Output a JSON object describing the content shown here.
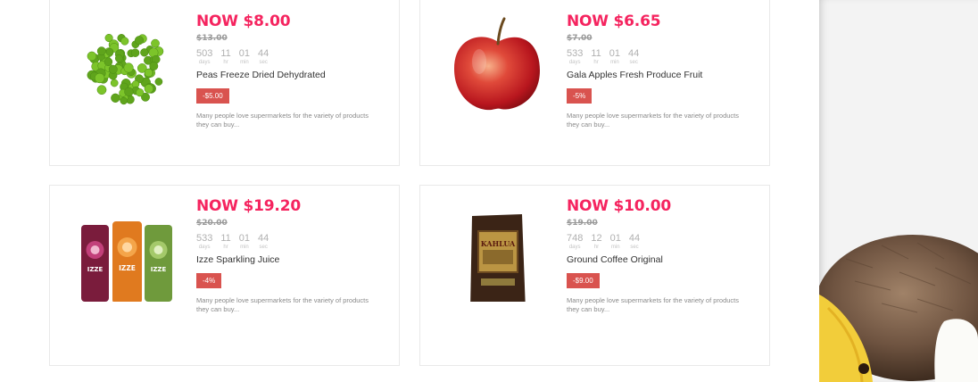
{
  "cards": [
    {
      "price_now": "NOW $8.00",
      "price_old": "$13.00",
      "countdown": [
        {
          "value": "503",
          "unit": "days"
        },
        {
          "value": "11",
          "unit": "hr"
        },
        {
          "value": "01",
          "unit": "min"
        },
        {
          "value": "44",
          "unit": "sec"
        }
      ],
      "name": "Peas Freeze Dried Dehydrated",
      "discount": "-$5.00",
      "description": "Many people love supermarkets for the variety of products they can buy..."
    },
    {
      "price_now": "NOW $6.65",
      "price_old": "$7.00",
      "countdown": [
        {
          "value": "533",
          "unit": "days"
        },
        {
          "value": "11",
          "unit": "hr"
        },
        {
          "value": "01",
          "unit": "min"
        },
        {
          "value": "44",
          "unit": "sec"
        }
      ],
      "name": "Gala Apples Fresh Produce Fruit",
      "discount": "-5%",
      "description": "Many people love supermarkets for the variety of products they can buy..."
    },
    {
      "price_now": "NOW $19.20",
      "price_old": "$20.00",
      "countdown": [
        {
          "value": "533",
          "unit": "days"
        },
        {
          "value": "11",
          "unit": "hr"
        },
        {
          "value": "01",
          "unit": "min"
        },
        {
          "value": "44",
          "unit": "sec"
        }
      ],
      "name": "Izze Sparkling Juice",
      "discount": "-4%",
      "description": "Many people love supermarkets for the variety of products they can buy...",
      "can_label": "IZZE"
    },
    {
      "price_now": "NOW $10.00",
      "price_old": "$19.00",
      "countdown": [
        {
          "value": "748",
          "unit": "days"
        },
        {
          "value": "12",
          "unit": "hr"
        },
        {
          "value": "01",
          "unit": "min"
        },
        {
          "value": "44",
          "unit": "sec"
        }
      ],
      "name": "Ground Coffee Original",
      "discount": "-$9.00",
      "description": "Many people love supermarkets for the variety of products they can buy...",
      "bag_label": "KAHLUA"
    }
  ],
  "colors": {
    "price_now": "#f5245f",
    "badge": "#d9534f"
  }
}
